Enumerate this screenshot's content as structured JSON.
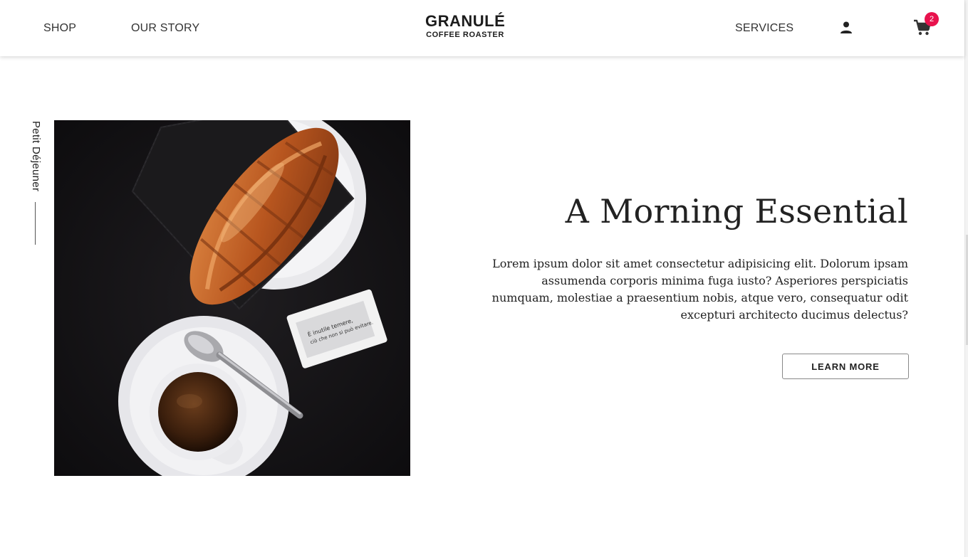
{
  "header": {
    "nav": {
      "shop": "SHOP",
      "our_story": "OUR STORY",
      "services": "SERVICES"
    },
    "logo": {
      "title": "GRANULÉ",
      "subtitle": "COFFEE ROASTER"
    },
    "icons": {
      "account": "person-icon",
      "cart": "shopping-cart-icon"
    },
    "cart_count": "2",
    "badge_color": "#e8124d"
  },
  "side_label": "Petit Déjeuner",
  "feature": {
    "title": "A Morning Essential",
    "body": "Lorem ipsum dolor sit amet consectetur adipisicing elit. Dolorum ipsam assumenda corporis minima fuga iusto? Asperiores perspiciatis numquam, molestiae a praesentium nobis, atque vero, consequatur odit excepturi architecto ducimus delectus?",
    "cta_label": "LEARN MORE"
  },
  "photo": {
    "sugar_packet_text": "È inutile temere, ciò che non si può evitare."
  }
}
